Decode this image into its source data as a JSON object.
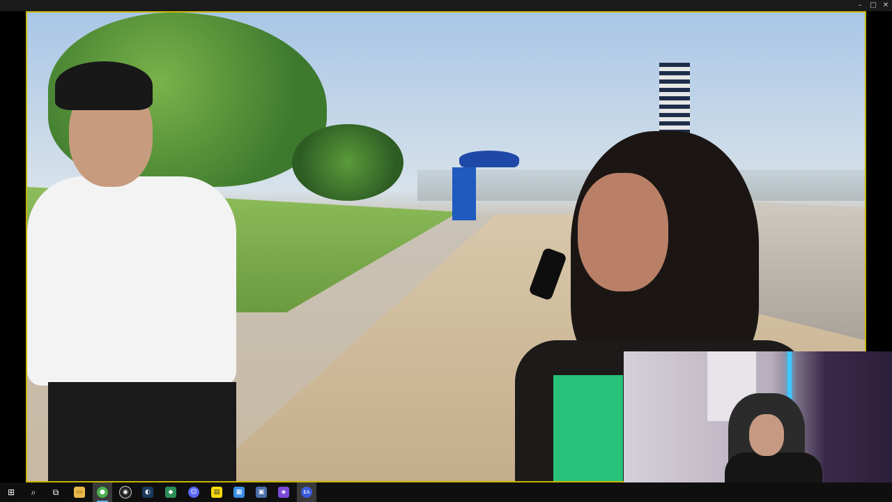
{
  "window": {
    "controls": {
      "minimize": "–",
      "maximize": "□",
      "close": "✕"
    }
  },
  "video": {
    "accent": "#c8b400"
  },
  "webcam": {
    "led_color": "#3cc8ff"
  },
  "taskbar": {
    "items": [
      {
        "name": "start",
        "icon": "windows-icon",
        "glyph": "⊞"
      },
      {
        "name": "search",
        "icon": "search-icon",
        "glyph": "⌕"
      },
      {
        "name": "task-view",
        "icon": "task-view-icon",
        "glyph": "⧉"
      },
      {
        "name": "file-explorer",
        "icon": "folder-icon",
        "glyph": "▭"
      },
      {
        "name": "chrome",
        "icon": "chrome-icon",
        "glyph": "●"
      },
      {
        "name": "obs",
        "icon": "obs-icon",
        "glyph": "◉"
      },
      {
        "name": "steam",
        "icon": "steam-icon",
        "glyph": "◐"
      },
      {
        "name": "app-green",
        "icon": "app-icon",
        "glyph": "◆"
      },
      {
        "name": "discord",
        "icon": "discord-icon",
        "glyph": "☺"
      },
      {
        "name": "sticky-notes",
        "icon": "note-icon",
        "glyph": "▤"
      },
      {
        "name": "calendar",
        "icon": "calendar-icon",
        "glyph": "▦"
      },
      {
        "name": "calculator",
        "icon": "calculator-icon",
        "glyph": "▣"
      },
      {
        "name": "app-purple",
        "icon": "app-icon",
        "glyph": "◈"
      },
      {
        "name": "ea-app",
        "icon": "ea-icon",
        "glyph": "EA"
      }
    ]
  }
}
